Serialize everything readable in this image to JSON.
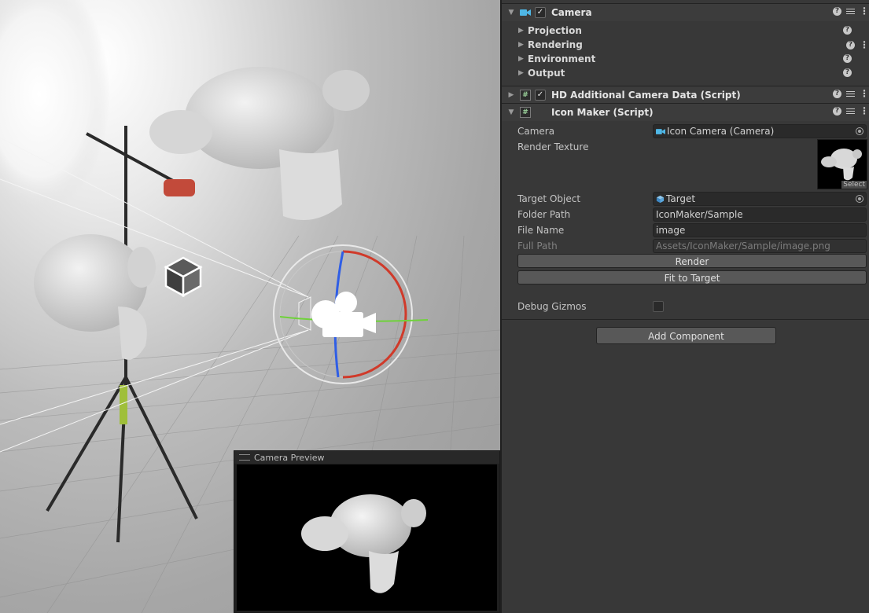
{
  "preview": {
    "title": "Camera Preview"
  },
  "inspector": {
    "camera_component": {
      "title": "Camera",
      "sections": [
        "Projection",
        "Rendering",
        "Environment",
        "Output"
      ]
    },
    "hd_component": {
      "title": "HD Additional Camera Data (Script)"
    },
    "icon_maker": {
      "title": "Icon Maker (Script)",
      "camera_label": "Camera",
      "camera_value": "Icon Camera (Camera)",
      "render_texture_label": "Render Texture",
      "render_texture_select": "Select",
      "target_label": "Target Object",
      "target_value": "Target",
      "folder_label": "Folder Path",
      "folder_value": "IconMaker/Sample",
      "file_label": "File Name",
      "file_value": "image",
      "full_path_label": "Full Path",
      "full_path_value": "Assets/IconMaker/Sample/image.png",
      "render_button": "Render",
      "fit_button": "Fit to Target",
      "debug_label": "Debug Gizmos",
      "debug_gizmos": false
    },
    "add_component": "Add Component",
    "icons": [
      "camera-icon",
      "script-icon",
      "help-icon",
      "presets-icon",
      "menu-icon",
      "object-picker-icon",
      "cube-icon"
    ]
  },
  "colors": {
    "camera_icon": "#4fb7e6",
    "gizmo_x": "#d03a2a",
    "gizmo_y": "#6fd23a",
    "gizmo_z": "#2f5ee6",
    "panel_bg": "#383838"
  }
}
